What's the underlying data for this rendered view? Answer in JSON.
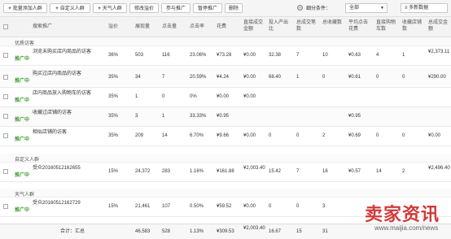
{
  "toolbar": {
    "buttons": [
      {
        "label": "批量添加人群",
        "plus": true
      },
      {
        "label": "自定义人群",
        "plus": true
      },
      {
        "label": "天气人群",
        "plus": true
      },
      {
        "label": "修改溢价",
        "plus": false
      },
      {
        "label": "参与推广",
        "plus": false
      },
      {
        "label": "暂停推广",
        "plus": false
      },
      {
        "label": "删除",
        "plus": false
      }
    ],
    "filter_label": "细分条件：",
    "filter_value": "全部",
    "newdata_label": "多新数据"
  },
  "header": [
    "搜索推广",
    "溢价",
    "展现量",
    "点击量",
    "点击率",
    "花费",
    "直接成交金额",
    "投入产出比",
    "总成交笔数",
    "总收藏数",
    "平均点击花费",
    "直接购物车数",
    "收藏店铺数",
    "总成交金额"
  ],
  "groups": [
    {
      "label": "优质访客",
      "rows": [
        {
          "name": "浏览未购买店内商品的访客",
          "status": "推广中",
          "bid": "36%",
          "pv": "503",
          "clk": "116",
          "ctr": "23.06%",
          "cost": "¥73.28",
          "direct": "¥0.00",
          "roi": "32.38",
          "orders": "7",
          "fav": "10",
          "cpc": "¥0.63",
          "cart": "4",
          "shopfav": "1",
          "total": "¥2,373.11"
        },
        {
          "name": "购买过店内商品的访客",
          "status": "推广中",
          "bid": "35%",
          "pv": "34",
          "clk": "7",
          "ctr": "20.59%",
          "cost": "¥4.24",
          "direct": "¥0.00",
          "roi": "68.40",
          "orders": "1",
          "fav": "0",
          "cpc": "¥0.61",
          "cart": "0",
          "shopfav": "0",
          "total": "¥290.00"
        },
        {
          "name": "店内商品放入购物车的访客",
          "status": "推广中",
          "bid": "35%",
          "pv": "1",
          "clk": "0",
          "ctr": "0%",
          "cost": "¥0.00",
          "direct": "¥0.00",
          "roi": "",
          "orders": "",
          "fav": "",
          "cpc": "",
          "cart": "",
          "shopfav": "",
          "total": ""
        },
        {
          "name": "收藏过店铺的访客",
          "status": "推广中",
          "bid": "35%",
          "pv": "3",
          "clk": "1",
          "ctr": "33.33%",
          "cost": "¥0.95",
          "direct": "",
          "roi": "",
          "orders": "",
          "fav": "",
          "cpc": "¥0.95",
          "cart": "",
          "shopfav": "",
          "total": ""
        },
        {
          "name": "相似店铺的访客",
          "status": "推广中",
          "bid": "35%",
          "pv": "209",
          "clk": "14",
          "ctr": "6.70%",
          "cost": "¥9.66",
          "direct": "¥0.00",
          "roi": "0",
          "orders": "0",
          "fav": "2",
          "cpc": "¥0.69",
          "cart": "0",
          "shopfav": "0",
          "total": "¥0.00"
        }
      ]
    },
    {
      "label": "自定义人群",
      "rows": [
        {
          "name": "受众20160512162655",
          "status": "推广中",
          "bid": "15%",
          "pv": "24,372",
          "clk": "283",
          "ctr": "1.16%",
          "cost": "¥161.88",
          "direct": "¥2,003.40",
          "roi": "15.42",
          "orders": "7",
          "fav": "16",
          "cpc": "¥0.57",
          "cart": "14",
          "shopfav": "2",
          "total": "¥2,496.40"
        }
      ]
    },
    {
      "label": "天气人群",
      "rows": [
        {
          "name": "受众20160512162729",
          "status": "推广中",
          "bid": "15%",
          "pv": "21,461",
          "clk": "107",
          "ctr": "0.50%",
          "cost": "¥59.52",
          "direct": "¥0.00",
          "roi": "0",
          "orders": "0",
          "fav": "3",
          "cpc": "",
          "cart": "",
          "shopfav": "",
          "total": ""
        }
      ]
    }
  ],
  "footer": {
    "label": "合计：汇总",
    "pv": "46,583",
    "clk": "528",
    "ctr": "1.13%",
    "cost": "¥309.53",
    "direct": "¥2,003.40",
    "roi": "16.67",
    "orders": "15",
    "fav": "31"
  },
  "watermark": {
    "title": "卖家资讯",
    "url": "www.maijia.com/news"
  }
}
